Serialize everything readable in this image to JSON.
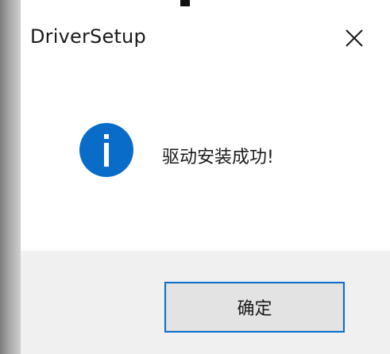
{
  "window": {
    "title": "DriverSetup",
    "close_icon": "close-icon"
  },
  "content": {
    "icon": "info-icon",
    "icon_symbol": "i",
    "message": "驱动安装成功!"
  },
  "footer": {
    "ok_label": "确定"
  },
  "colors": {
    "info_blue": "#0a6cc9",
    "button_border": "#0b6fd0",
    "footer_bg": "#f0f0f0"
  }
}
